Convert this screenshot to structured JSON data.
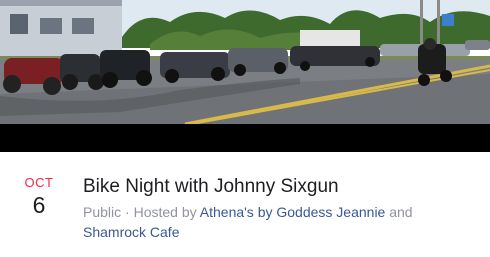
{
  "event": {
    "month": "OCT",
    "day": "6",
    "title": "Bike Night with Johnny Sixgun",
    "privacy": "Public",
    "separator": "·",
    "hosted_by_prefix": "Hosted by",
    "host_1": "Athena's by Goddess Jeannie",
    "conjunction": "and",
    "host_2": "Shamrock Cafe"
  },
  "colors": {
    "month_red": "#f02849",
    "link_blue": "#385898",
    "meta_gray": "#90949c",
    "title_black": "#1c1e21"
  }
}
